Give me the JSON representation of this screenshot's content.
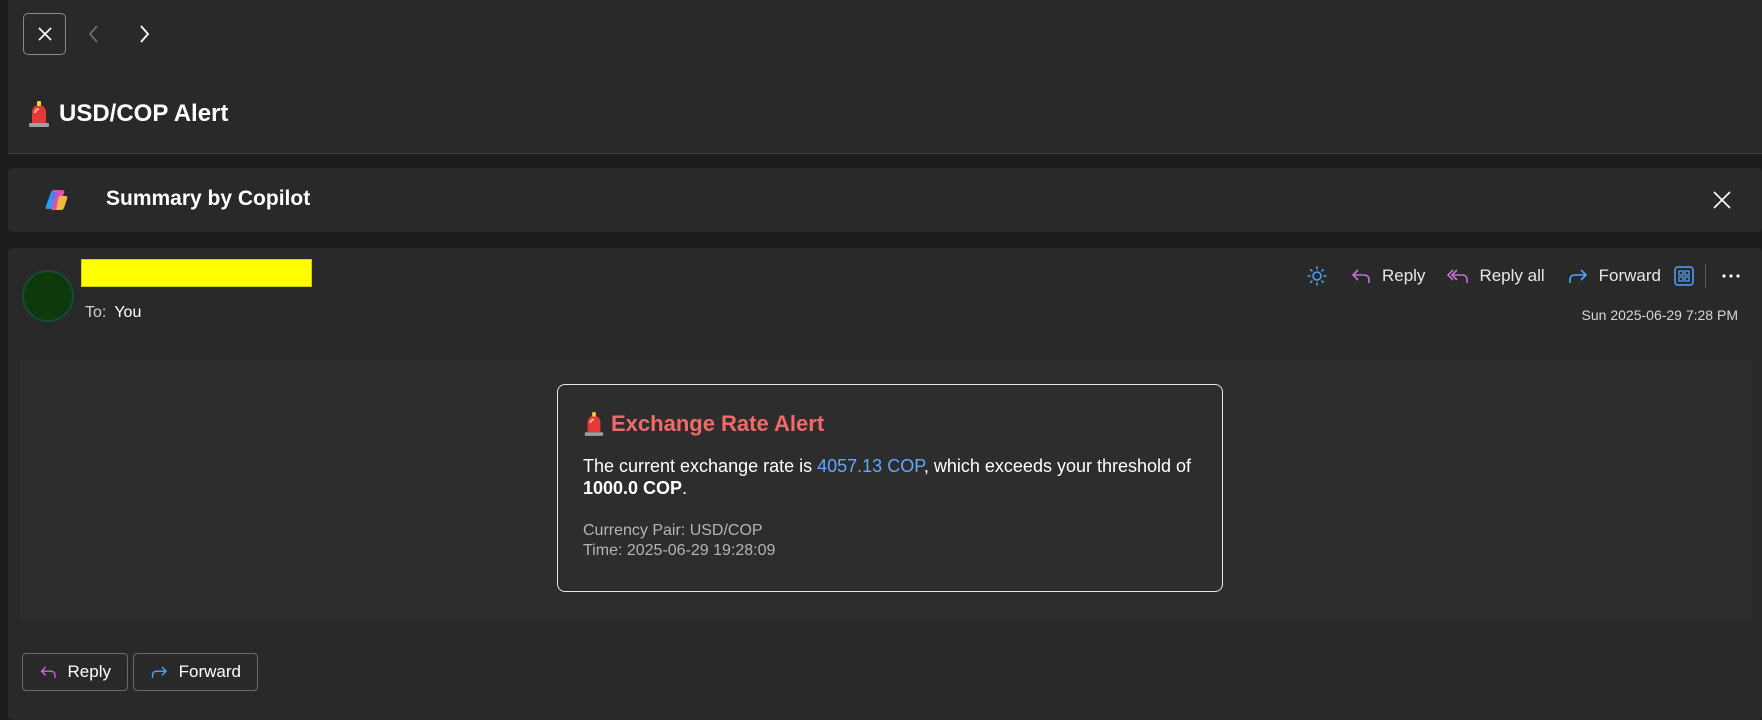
{
  "header": {
    "subject": "USD/COP Alert",
    "subject_icon": "siren-icon"
  },
  "copilot": {
    "title": "Summary by Copilot"
  },
  "message": {
    "to_label": "To:",
    "to_value": "You",
    "date": "Sun 2025-06-29 7:28 PM",
    "actions": {
      "reply": "Reply",
      "reply_all": "Reply all",
      "forward": "Forward"
    }
  },
  "alert": {
    "title": "Exchange Rate Alert",
    "text_before": "The current exchange rate is ",
    "rate": "4057.13 COP",
    "text_middle": ", which exceeds your threshold of ",
    "threshold": "1000.0 COP",
    "text_after": ".",
    "currency_pair": "Currency Pair: USD/COP",
    "time": "Time: 2025-06-29 19:28:09"
  },
  "footer": {
    "reply": "Reply",
    "forward": "Forward"
  },
  "colors": {
    "background": "#292929",
    "alert_title": "#f06a6a",
    "rate_link": "#62a8ff",
    "reply_icon": "#c86dd7",
    "forward_icon": "#4ea6ff",
    "sender_highlight": "#ffff00"
  }
}
